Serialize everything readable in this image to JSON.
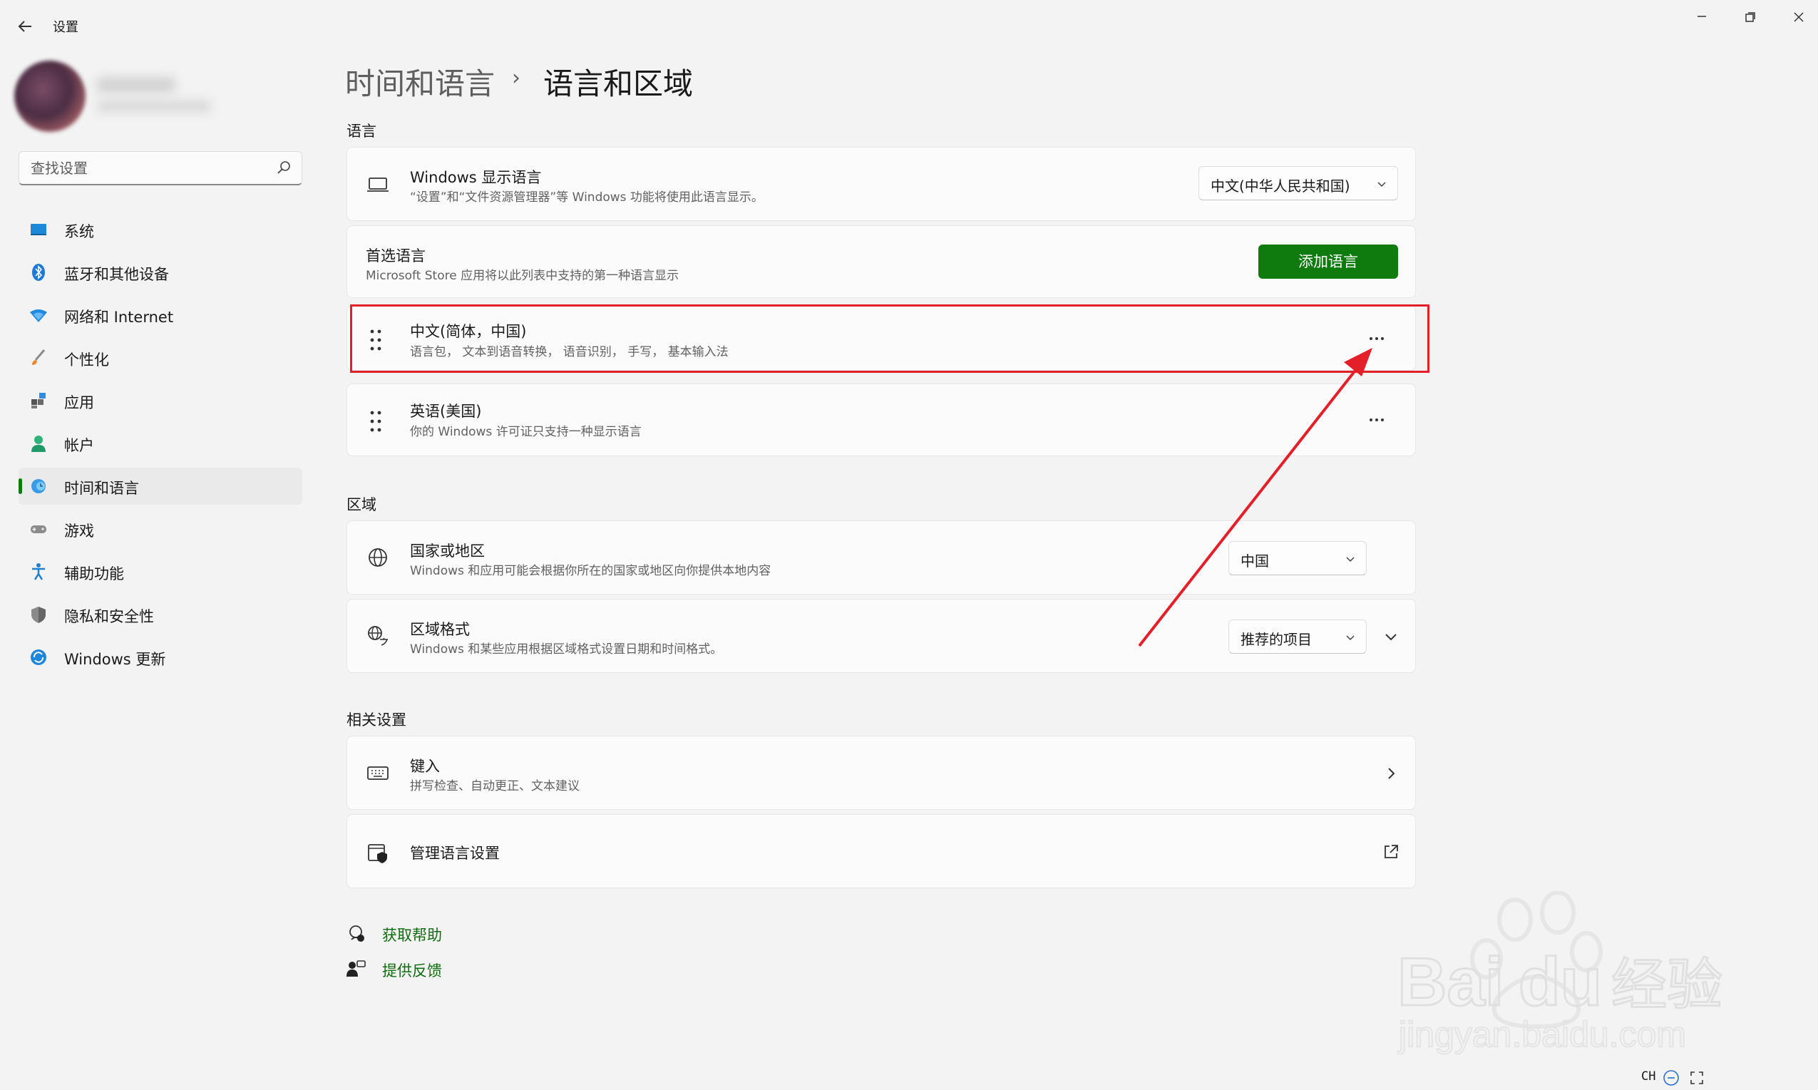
{
  "app": {
    "title": "设置"
  },
  "sidebar": {
    "search_placeholder": "查找设置",
    "items": [
      {
        "label": "系统",
        "icon": "monitor-icon"
      },
      {
        "label": "蓝牙和其他设备",
        "icon": "bluetooth-icon"
      },
      {
        "label": "网络和 Internet",
        "icon": "wifi-icon"
      },
      {
        "label": "个性化",
        "icon": "brush-icon"
      },
      {
        "label": "应用",
        "icon": "apps-icon"
      },
      {
        "label": "帐户",
        "icon": "person-icon"
      },
      {
        "label": "时间和语言",
        "icon": "globe-clock-icon",
        "active": true
      },
      {
        "label": "游戏",
        "icon": "gamepad-icon"
      },
      {
        "label": "辅助功能",
        "icon": "accessibility-icon"
      },
      {
        "label": "隐私和安全性",
        "icon": "shield-icon"
      },
      {
        "label": "Windows 更新",
        "icon": "update-icon"
      }
    ]
  },
  "breadcrumb": {
    "parent": "时间和语言",
    "separator": "›",
    "current": "语言和区域"
  },
  "sections": {
    "language": "语言",
    "region": "区域",
    "related": "相关设置"
  },
  "language": {
    "display": {
      "title": "Windows 显示语言",
      "subtitle": "“设置”和“文件资源管理器”等 Windows 功能将使用此语言显示。",
      "value": "中文(中华人民共和国)"
    },
    "preferred": {
      "title": "首选语言",
      "subtitle": "Microsoft Store 应用将以此列表中支持的第一种语言显示",
      "button": "添加语言"
    },
    "list": [
      {
        "title": "中文(简体，中国)",
        "subtitle": "语言包， 文本到语音转换， 语音识别， 手写， 基本输入法"
      },
      {
        "title": "英语(美国)",
        "subtitle": "你的 Windows 许可证只支持一种显示语言"
      }
    ],
    "more_label": "···"
  },
  "region": {
    "country": {
      "title": "国家或地区",
      "subtitle": "Windows 和应用可能会根据你所在的国家或地区向你提供本地内容",
      "value": "中国"
    },
    "format": {
      "title": "区域格式",
      "subtitle": "Windows 和某些应用根据区域格式设置日期和时间格式。",
      "value": "推荐的项目"
    }
  },
  "related": {
    "typing": {
      "title": "键入",
      "subtitle": "拼写检查、自动更正、文本建议"
    },
    "manage": {
      "title": "管理语言设置"
    }
  },
  "help": {
    "get_help": "获取帮助",
    "feedback": "提供反馈"
  },
  "taskbar": {
    "ime": "CH"
  },
  "watermark": {
    "brand": "Baidu经验",
    "url": "jingyan.baidu.com"
  },
  "colors": {
    "accent": "#0f7b0f",
    "highlight": "#e3202a"
  }
}
